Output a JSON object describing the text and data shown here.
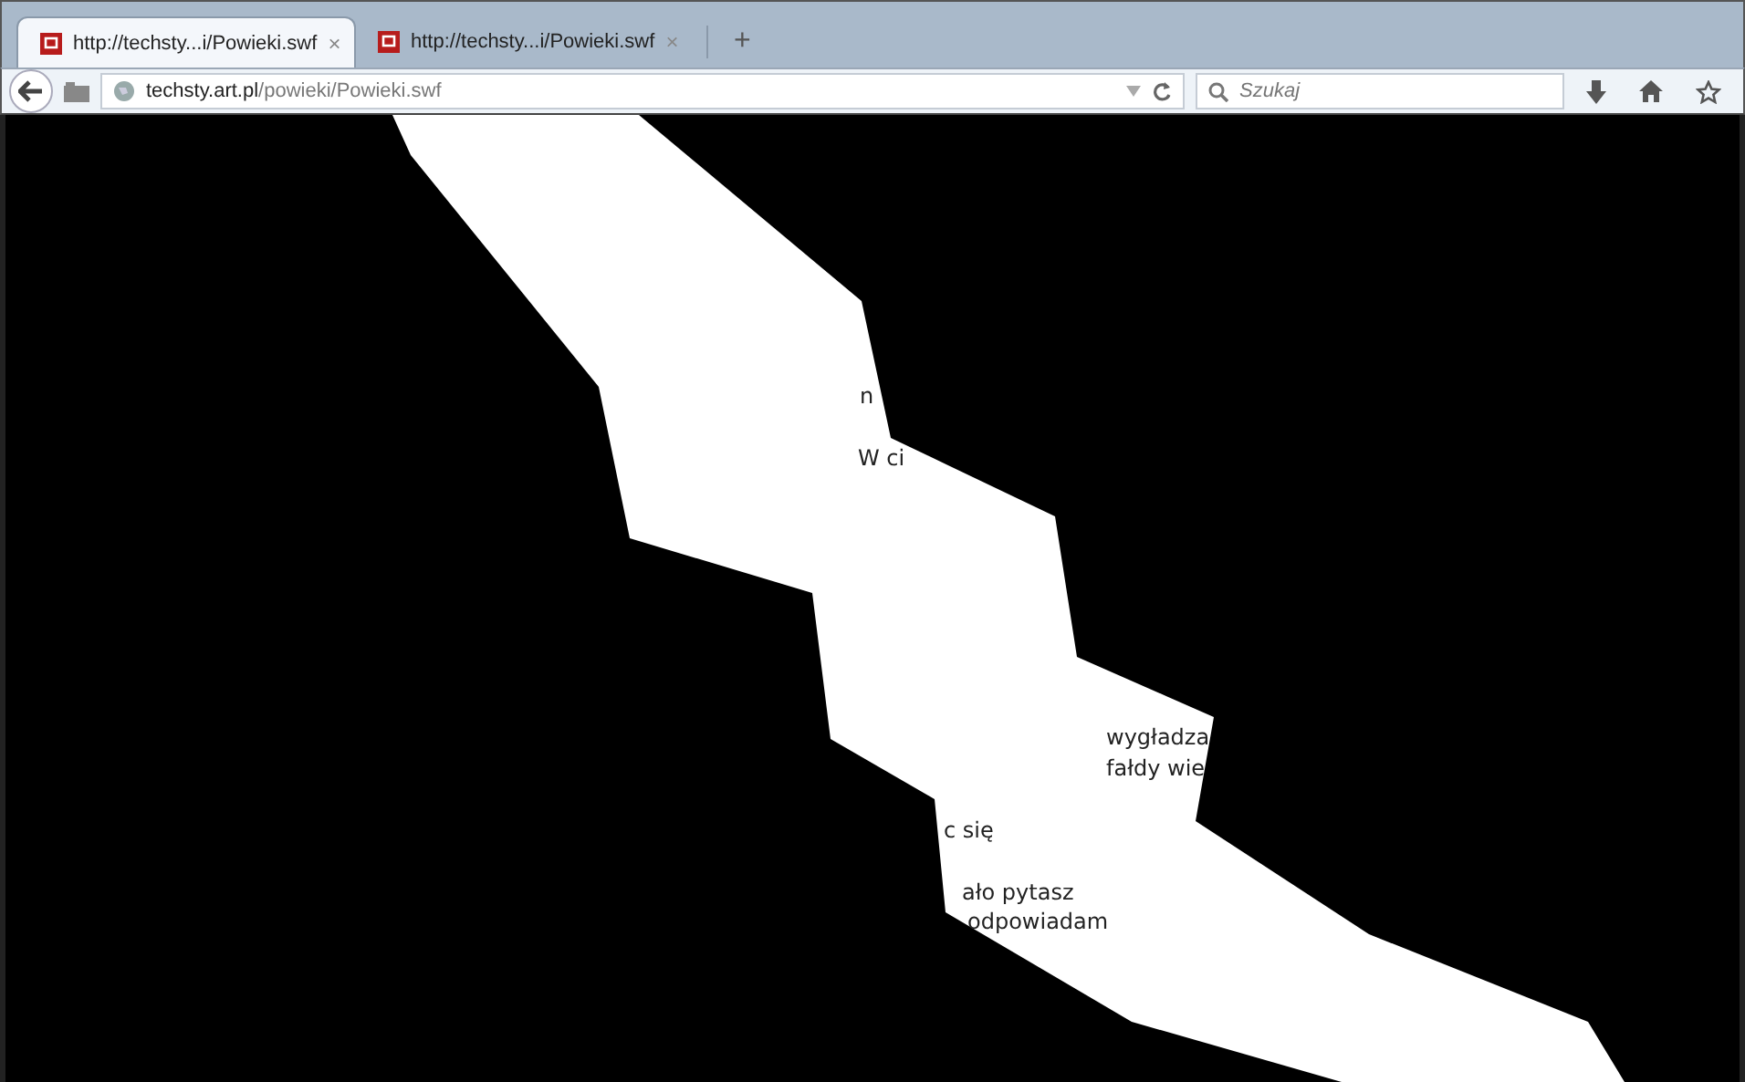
{
  "tabs": [
    {
      "title": "http://techsty...i/Powieki.swf",
      "close": "×",
      "selected": true
    },
    {
      "title": "http://techsty...i/Powieki.swf",
      "close": "×",
      "selected": false
    }
  ],
  "new_tab": "+",
  "address": {
    "host": "techsty.art.pl",
    "path": "/powieki/Powieki.swf"
  },
  "search": {
    "placeholder": "Szukaj"
  },
  "stage": {
    "texts": [
      {
        "text": "n"
      },
      {
        "text": "W ci"
      },
      {
        "text": "wygładza"
      },
      {
        "text": "fałdy wie"
      },
      {
        "text": "c się"
      },
      {
        "text": "ało pytasz"
      },
      {
        "text": "odpowiadam"
      }
    ]
  }
}
